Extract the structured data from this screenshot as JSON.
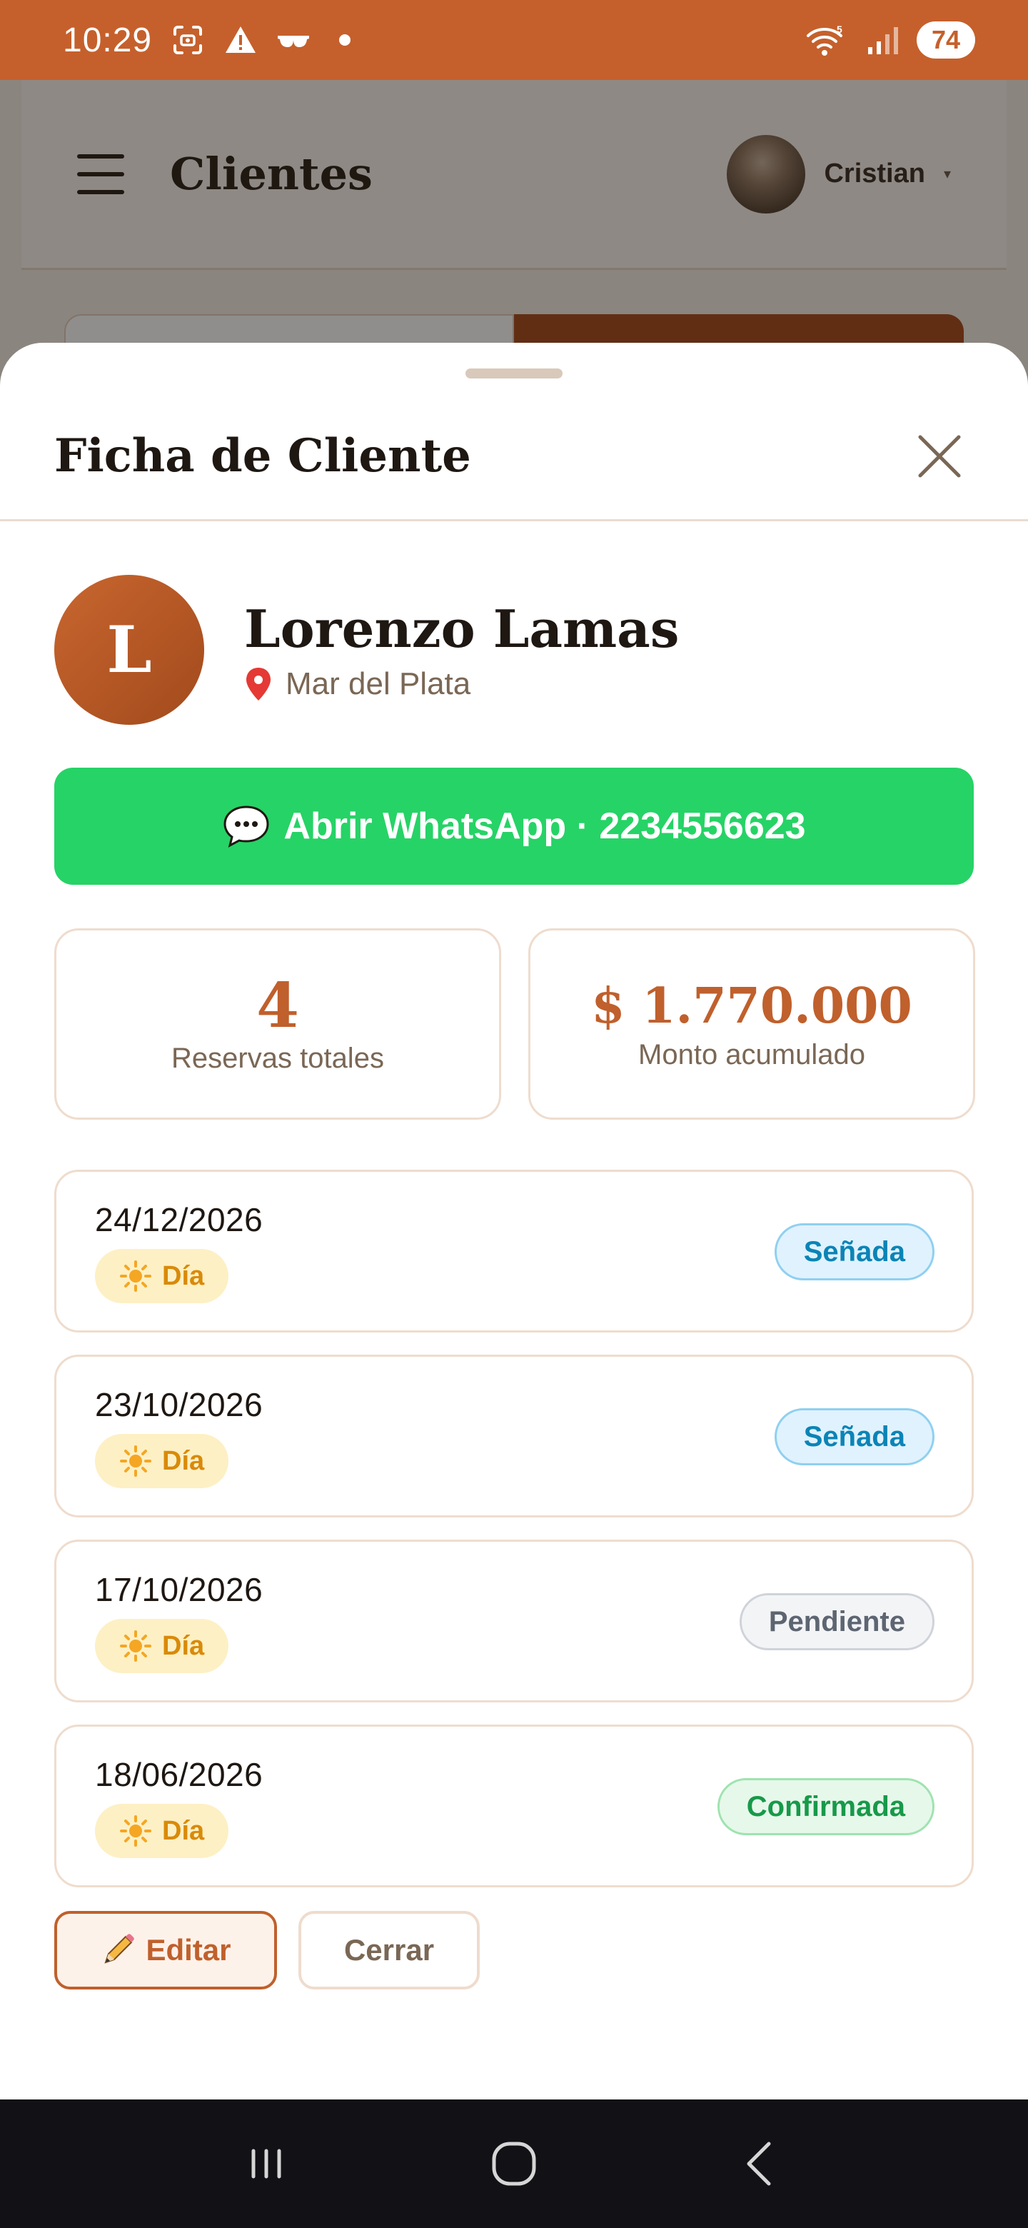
{
  "status_bar": {
    "time": "10:29",
    "battery": "74",
    "background": "#c5602c",
    "icons": [
      "screenshot-icon",
      "warning-icon",
      "glasses-icon",
      "dot-icon",
      "wifi-icon",
      "signal-icon",
      "battery-icon"
    ]
  },
  "background_app": {
    "title": "Clientes",
    "user_name": "Cristian",
    "caret": "▾"
  },
  "sheet": {
    "title": "Ficha de Cliente",
    "client": {
      "initial": "L",
      "name": "Lorenzo Lamas",
      "location": "Mar del Plata"
    },
    "whatsapp": {
      "label": "Abrir WhatsApp · 2234556623",
      "color": "#26d366"
    },
    "stats": [
      {
        "value": "4",
        "label": "Reservas totales"
      },
      {
        "value": "$ 1.770.000",
        "label": "Monto acumulado"
      }
    ],
    "reservations": [
      {
        "date": "24/12/2026",
        "tag": "Día",
        "status": "Señada"
      },
      {
        "date": "23/10/2026",
        "tag": "Día",
        "status": "Señada"
      },
      {
        "date": "17/10/2026",
        "tag": "Día",
        "status": "Pendiente"
      },
      {
        "date": "18/06/2026",
        "tag": "Día",
        "status": "Confirmada"
      }
    ],
    "actions": {
      "edit": "Editar",
      "close": "Cerrar"
    }
  },
  "nav_bar": {
    "icons": [
      "recent-apps-icon",
      "home-icon",
      "back-icon"
    ]
  }
}
